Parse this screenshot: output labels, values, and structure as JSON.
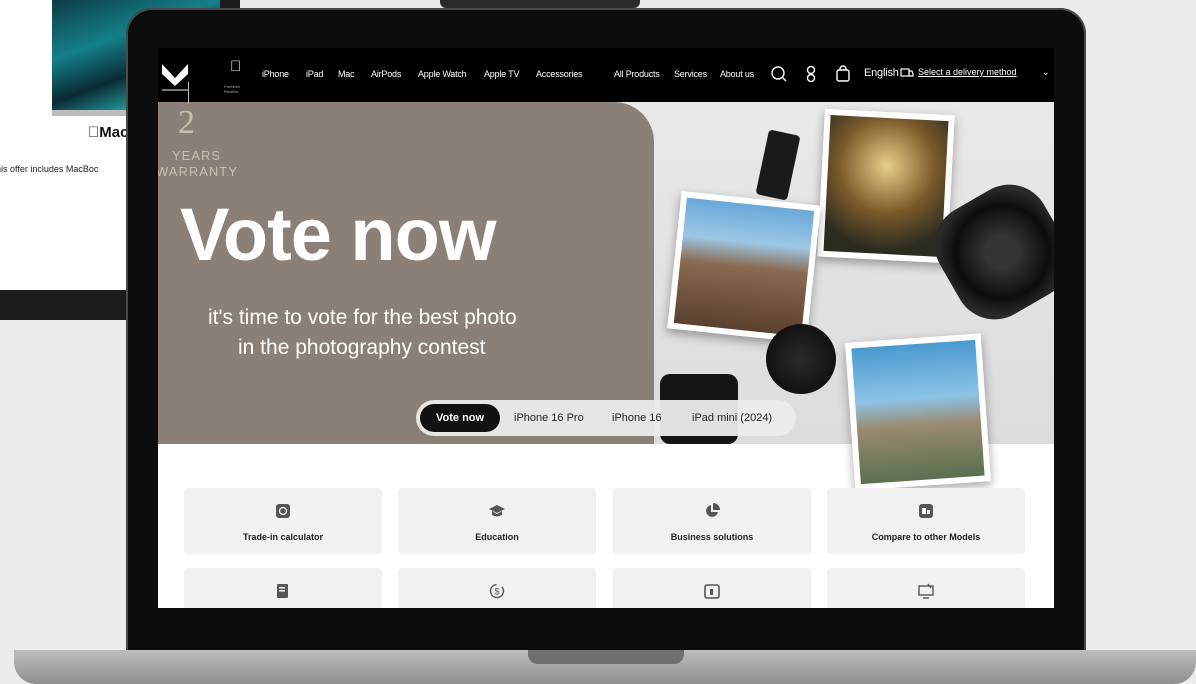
{
  "background_page": {
    "brand": "Mac",
    "offer_text": "his offer includes MacBoc"
  },
  "nav": {
    "apple_caption": "Premium Reseller",
    "links": [
      "iPhone",
      "iPad",
      "Mac",
      "AirPods",
      "Apple Watch",
      "Apple TV",
      "Accessories",
      "All Products",
      "Services",
      "About us"
    ],
    "language": "English",
    "delivery": "Select a delivery method"
  },
  "hero": {
    "warranty_number": "2",
    "warranty_line1": "YEARS",
    "warranty_line2": "WARRANTY",
    "title": "Vote now",
    "subtitle_line1": "it's time to vote for the best photo",
    "subtitle_line2": "in the photography contest",
    "tabs": [
      "Vote now",
      "iPhone 16 Pro",
      "iPhone 16",
      "iPad mini (2024)"
    ],
    "active_tab": "Vote now"
  },
  "services": [
    {
      "label": "Trade-in calculator",
      "icon": "trade-in-icon"
    },
    {
      "label": "Education",
      "icon": "graduation-cap-icon"
    },
    {
      "label": "Business solutions",
      "icon": "pie-chart-icon"
    },
    {
      "label": "Compare to other Models",
      "icon": "compare-icon"
    },
    {
      "label": "",
      "icon": "document-icon"
    },
    {
      "label": "",
      "icon": "dollar-cycle-icon"
    },
    {
      "label": "",
      "icon": "calendar-icon"
    },
    {
      "label": "",
      "icon": "monitor-icon"
    }
  ],
  "colors": {
    "hero_panel": "#8a8078",
    "nav_bg": "#000000",
    "warranty": "#c8bfae"
  }
}
